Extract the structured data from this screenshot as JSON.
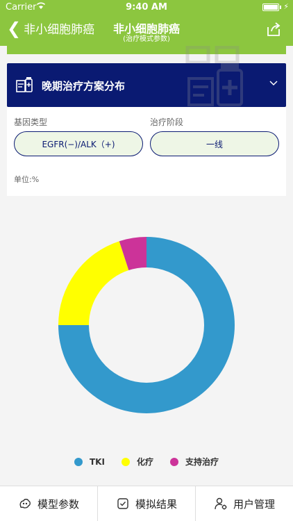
{
  "status_bar": {
    "carrier": "Carrier",
    "time": "9:40 AM"
  },
  "nav": {
    "back_label": "非小细胞肺癌",
    "title": "非小细胞肺癌",
    "subtitle": "(治疗模式参数)"
  },
  "section": {
    "title": "晚期治疗方案分布"
  },
  "filters": {
    "gene_label": "基因类型",
    "gene_value": "EGFR(−)/ALK（+)",
    "stage_label": "治疗阶段",
    "stage_value": "一线",
    "unit": "单位:%"
  },
  "colors": {
    "nav_green": "#8cc63f",
    "header_navy": "#0a1a72",
    "tki": "#3399cc",
    "chemo": "#ffff00",
    "support": "#cc3399"
  },
  "chart_data": {
    "type": "pie",
    "donut": true,
    "categories": [
      "TKI",
      "化疗",
      "支持治疗"
    ],
    "values": [
      75,
      20,
      5
    ],
    "colors": [
      "#3399cc",
      "#ffff00",
      "#cc3399"
    ],
    "legend_position": "bottom"
  },
  "tabs": [
    {
      "label": "模型参数",
      "icon": "model-icon"
    },
    {
      "label": "模拟结果",
      "icon": "result-icon"
    },
    {
      "label": "用户管理",
      "icon": "user-settings-icon"
    }
  ]
}
